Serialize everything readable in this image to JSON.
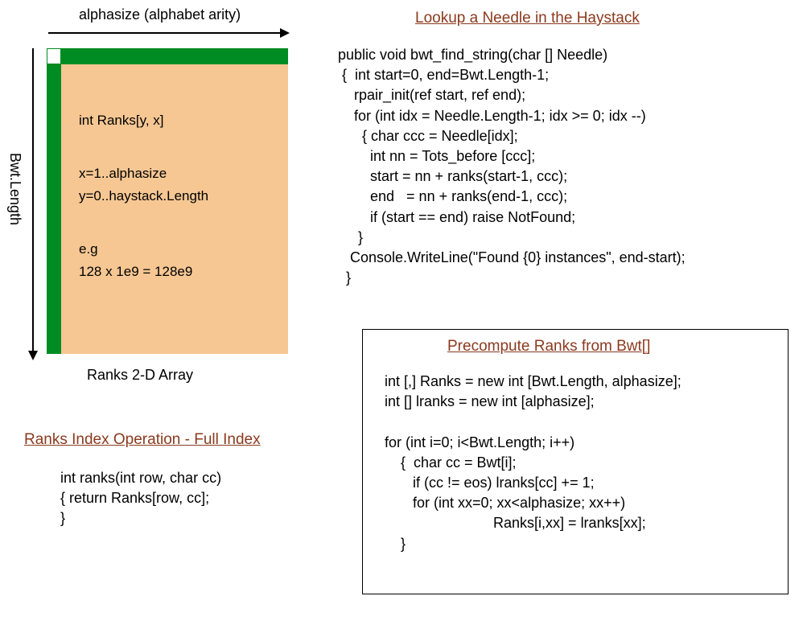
{
  "top_label": "alphasize (alphabet arity)",
  "left_label": "Bwt.Length",
  "ranks_body": {
    "line1": "int Ranks[y, x]",
    "line2": "x=1..alphasize",
    "line3": "y=0..haystack.Length",
    "line4": "e.g",
    "line5": "128 x 1e9 = 128e9"
  },
  "ranks_caption": "Ranks 2-D Array",
  "ranks_index": {
    "heading": "Ranks Index Operation - Full Index",
    "line1": "int ranks(int row, char cc)",
    "line2": "{ return Ranks[row, cc];",
    "line3": "}"
  },
  "lookup": {
    "heading": "Lookup a Needle in the Haystack",
    "code": "public void bwt_find_string(char [] Needle)\n {  int start=0, end=Bwt.Length-1;\n    rpair_init(ref start, ref end);\n    for (int idx = Needle.Length-1; idx >= 0; idx --)\n      { char ccc = Needle[idx];\n        int nn = Tots_before [ccc];\n        start = nn + ranks(start-1, ccc);\n        end   = nn + ranks(end-1, ccc);\n        if (start == end) raise NotFound;\n     }\n   Console.WriteLine(\"Found {0} instances\", end-start);\n  }"
  },
  "precompute": {
    "heading": "Precompute Ranks from Bwt[]",
    "code": "int [,] Ranks = new int [Bwt.Length, alphasize];\nint [] lranks = new int [alphasize];\n\nfor (int i=0; i<Bwt.Length; i++)\n    {  char cc = Bwt[i];\n       if (cc != eos) lranks[cc] += 1;\n       for (int xx=0; xx<alphasize; xx++)\n                           Ranks[i,xx] = lranks[xx];\n    }"
  }
}
